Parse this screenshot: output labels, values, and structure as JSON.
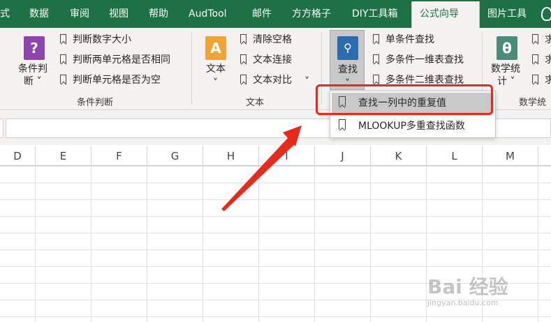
{
  "tabs": [
    {
      "label": "式",
      "active": false
    },
    {
      "label": "数据",
      "active": false
    },
    {
      "label": "审阅",
      "active": false
    },
    {
      "label": "视图",
      "active": false
    },
    {
      "label": "帮助",
      "active": false
    },
    {
      "label": "AudTool",
      "active": false
    },
    {
      "label": "邮件",
      "active": false
    },
    {
      "label": "方方格子",
      "active": false
    },
    {
      "label": "DIY工具箱",
      "active": false
    },
    {
      "label": "公式向导",
      "active": true
    },
    {
      "label": "图片工具",
      "active": false
    }
  ],
  "ribbon": {
    "logic_group": {
      "big_button": {
        "label_line1": "条件判",
        "label_line2": "断 ˅",
        "icon_glyph": "?"
      },
      "items": [
        "判断数字大小",
        "判断两单元格是否相同",
        "判断单元格是否为空"
      ],
      "label": "条件判断"
    },
    "text_group": {
      "big_button": {
        "label_line1": "文本",
        "label_line2": "˅",
        "icon_glyph": "A"
      },
      "items": [
        "清除空格",
        "文本连接",
        "文本对比"
      ],
      "more": "˅",
      "label": "文本"
    },
    "lookup_group": {
      "big_button": {
        "label_line1": "查找",
        "label_line2": "˅",
        "icon": "magnifier-icon"
      },
      "items": [
        "单条件查找",
        "多条件一维表查找",
        "多条件二维表查找"
      ]
    },
    "math_group": {
      "big_button": {
        "label_line1": "数学统",
        "label_line2": "计 ˅",
        "icon_glyph": "θ"
      },
      "items": [
        "求",
        "求",
        "求"
      ],
      "label": "数学统"
    }
  },
  "dropdown": {
    "items": [
      "查找一列中的重复值",
      "MLOOKUP多重查找函数"
    ],
    "hovered_index": 0
  },
  "columns": [
    "D",
    "E",
    "F",
    "G",
    "H",
    "I",
    "J",
    "K",
    "L",
    "M"
  ],
  "watermark": {
    "text": "Bai 经验",
    "url": "jingyan.baidu.com"
  },
  "colors": {
    "tab_bar": "#1e7145",
    "ribbon_bg": "#f3f2f1",
    "highlight": "#e8291c",
    "arrow": "#e8291c"
  }
}
